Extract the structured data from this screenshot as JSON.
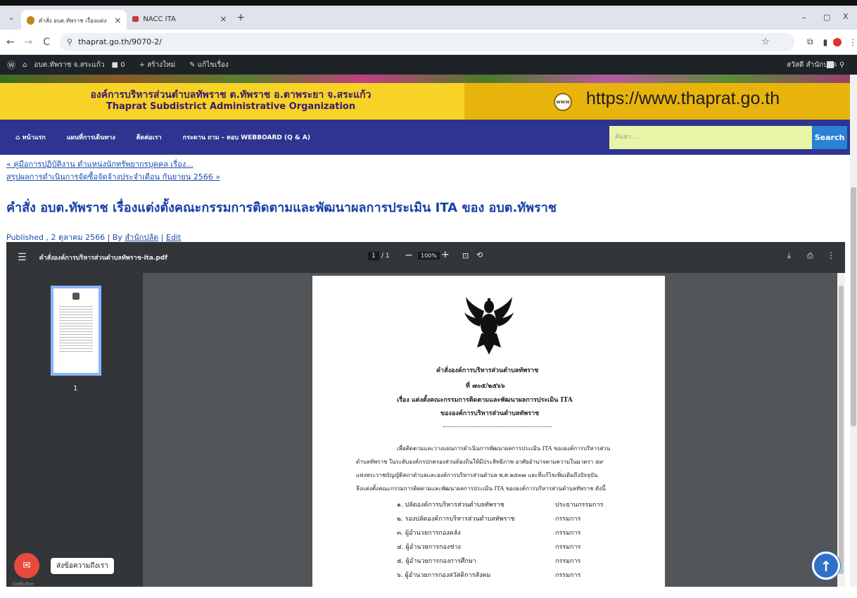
{
  "browser": {
    "tabs": [
      {
        "title": "คำสั่ง อบต.ทัพราช เรื่องแต่งตั้งคณะก",
        "favicon_color": "#b88c12"
      },
      {
        "title": "NACC ITA",
        "favicon_color": "#c23b3b"
      }
    ],
    "new_tab": "+",
    "url": "thaprat.go.th/9070-2/",
    "window_controls": [
      "–",
      "▢",
      "X"
    ]
  },
  "wp_admin": {
    "site": "อบต.ทัพราช จ.สระแก้ว",
    "comments": "0",
    "new": "สร้างใหม่",
    "edit": "แก้ไขเรื่อง",
    "greeting": "สวัสดี สำนักปลัด"
  },
  "banner": {
    "org_th": "องค์การบริหารส่วนตำบลทัพราช ต.ทัพราช อ.ตาพระยา จ.สระแก้ว",
    "org_en": "Thaprat Subdistrict Administrative Organization",
    "www_badge": "www",
    "url": "https://www.thaprat.go.th"
  },
  "site_nav": {
    "items": [
      "หน้าแรก",
      "แผนที่การเดินทาง",
      "ติดต่อเรา",
      "กระดาน ถาม – ตอบ WEBBOARD (Q & A)"
    ],
    "search_placeholder": "ค้นหา.....",
    "search_button": "Search"
  },
  "post": {
    "prev_link": "« คู่มือการปฏิบัติงาน ตำแหน่งนักทรัพยากรบุคคล เรื่อง...",
    "next_link": "สรุปผลการดำเนินการจัดซื้อจัดจ้างประจำเดือน กันยายน 2566 »",
    "title": "คำสั่ง อบต.ทัพราช เรื่องแต่งตั้งคณะกรรมการติดตามและพัฒนาผลการประเมิน ITA ของ อบต.ทัพราช",
    "meta_published": "Published , 2 ตุลาคม 2566 | By ",
    "meta_author": "สำนักปลัด",
    "meta_sep": " | ",
    "meta_edit": "Edit"
  },
  "pdf": {
    "filename": "คำสั่งองค์การบริหารส่วนตำบลทัพราช-ita.pdf",
    "page_current": "1",
    "page_total": "/ 1",
    "zoom": "100%",
    "thumb_label": "1",
    "doc": {
      "heading": "คำสั่งองค์การบริหารส่วนตำบลทัพราช",
      "number": "ที่ ๗๐๕/๒๕๖๖",
      "subject": "เรื่อง  แต่งตั้งคณะกรรมการติดตามและพัฒนาผลการประเมิน ITA",
      "subject2": "ขององค์การบริหารส่วนตำบลทัพราช",
      "p1": "เพื่อติดตามและวางแผนการดำเนินการพัฒนาผลการประเมิน ITA ขององค์การบริหารส่วน",
      "p2": "ตำบลทัพราช ในระดับองค์กรปกครองส่วนท้องถิ่นให้มีประสิทธิภาพ อาศัยอำนาจตามความในมาตรา ๕๙",
      "p3": "แห่งพระราชบัญญัติสภาตำบลและองค์การบริหารส่วนตำบล พ.ศ.๒๕๓๗ และที่แก้ไขเพิ่มเติมถึงปัจจุบัน",
      "p4": "จึงแต่งตั้งคณะกรรมการติดตามและพัฒนาผลการประเมิน ITA ขององค์การบริหารส่วนตำบลทัพราช ดังนี้",
      "members": [
        {
          "name": "๑. ปลัดองค์การบริหารส่วนตำบลทัพราช",
          "role": "ประธานกรรมการ"
        },
        {
          "name": "๒. รองปลัดองค์การบริหารส่วนตำบลทัพราช",
          "role": "กรรมการ"
        },
        {
          "name": "๓. ผู้อำนวยการกองคลัง",
          "role": "กรรมการ"
        },
        {
          "name": "๔. ผู้อำนวยการกองช่าง",
          "role": "กรรมการ"
        },
        {
          "name": "๕. ผู้อำนวยการกองการศึกษา",
          "role": "กรรมการ"
        },
        {
          "name": "๖. ผู้อำนวยการกองสวัสดิการสังคม",
          "role": "กรรมการ"
        }
      ]
    }
  },
  "chat": {
    "tooltip": "ส่งข้อความถึงเรา",
    "brand": "GetButton"
  }
}
